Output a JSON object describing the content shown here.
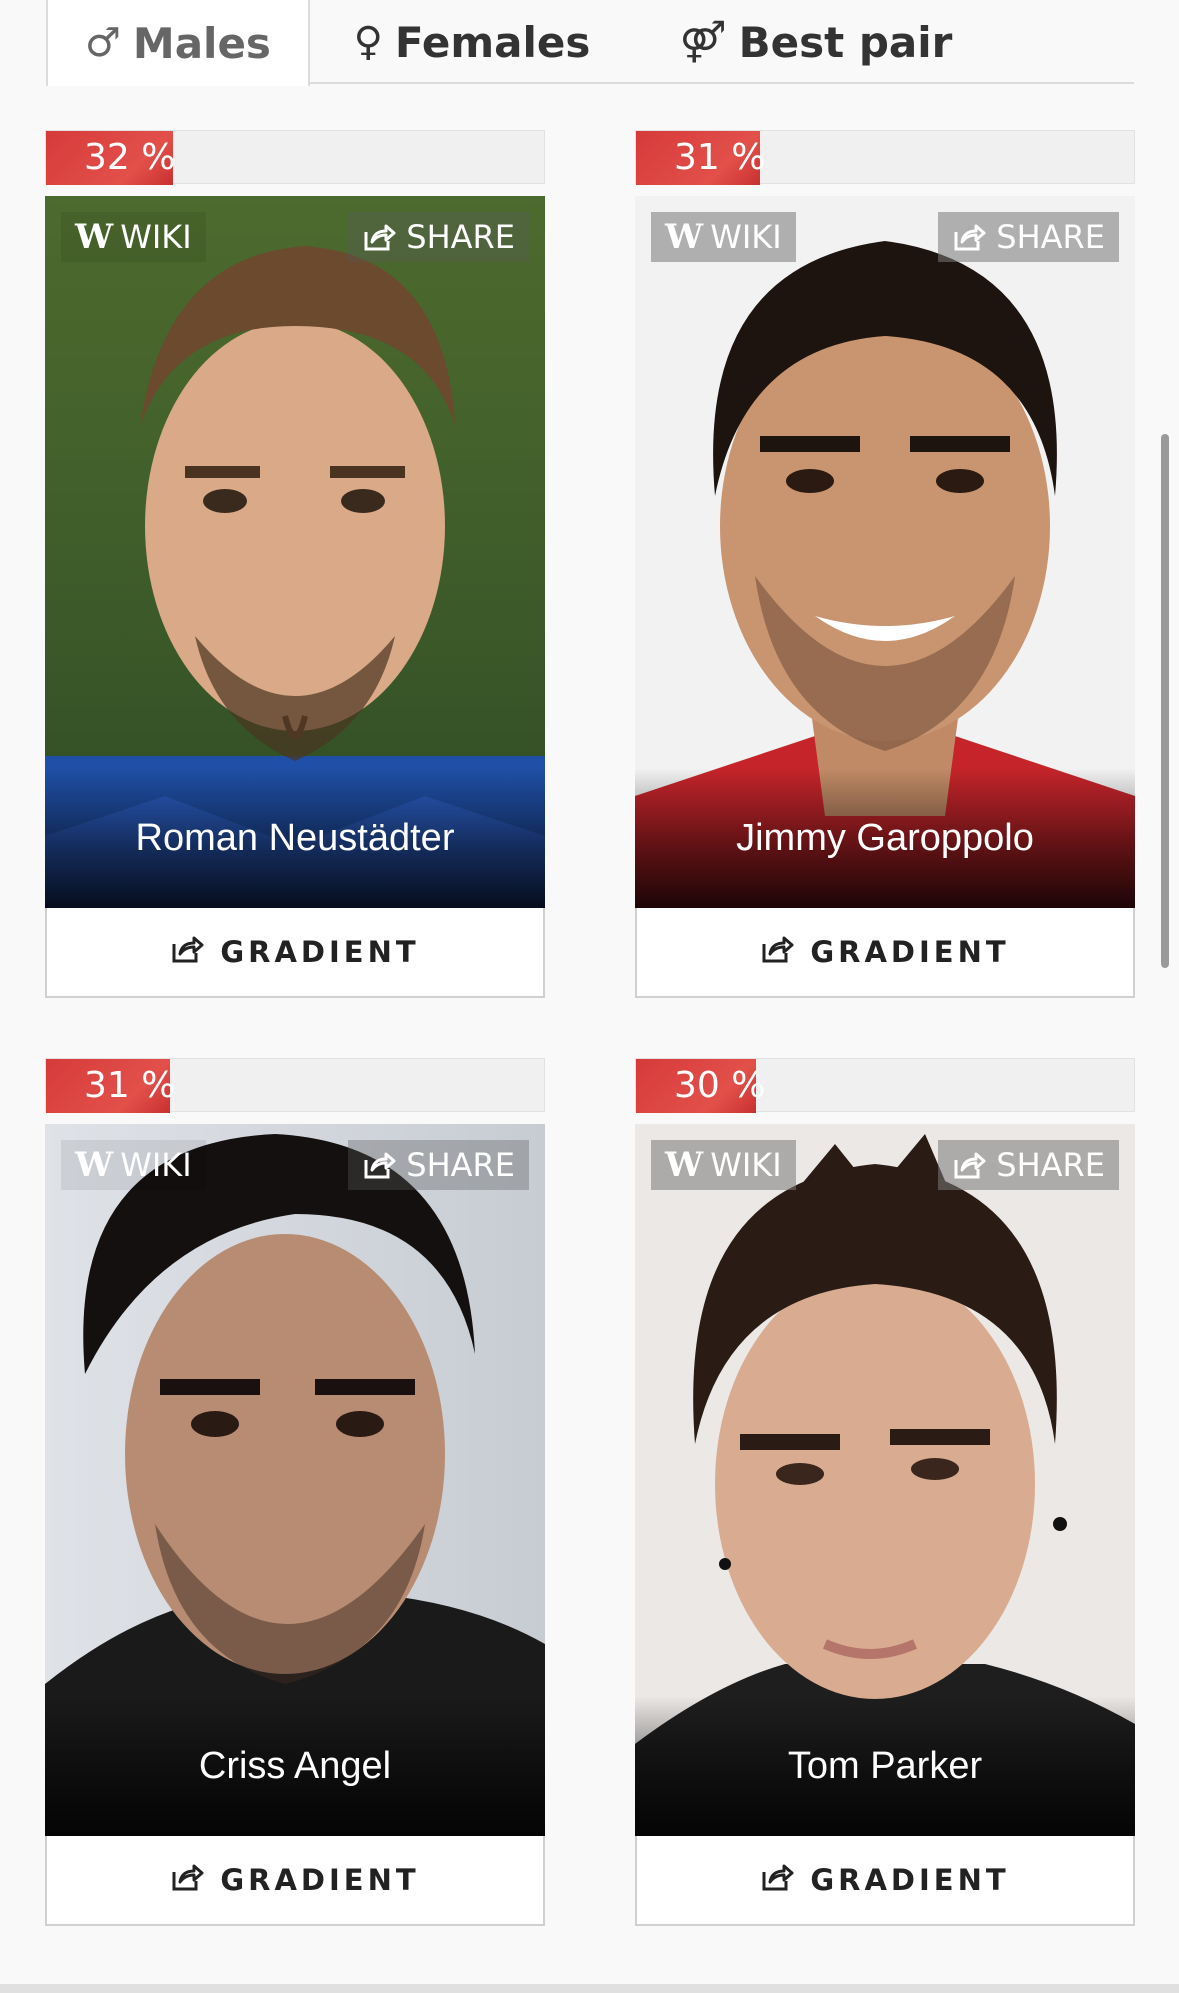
{
  "tabs": [
    {
      "symbol": "♂",
      "label": "Males",
      "active": true
    },
    {
      "symbol": "♀",
      "label": "Females",
      "active": false
    },
    {
      "symbol": "⚤",
      "label": "Best pair",
      "active": false
    }
  ],
  "button_labels": {
    "wiki": "WIKI",
    "share": "SHARE",
    "gradient": "GRADIENT"
  },
  "cards": [
    {
      "percent_text": "32 %",
      "percent": 32,
      "name": "Roman Neustädter"
    },
    {
      "percent_text": "31 %",
      "percent": 31,
      "name": "Jimmy Garoppolo"
    },
    {
      "percent_text": "31 %",
      "percent": 31,
      "name": "Criss Angel"
    },
    {
      "percent_text": "30 %",
      "percent": 30,
      "name": "Tom Parker"
    }
  ],
  "colors": {
    "accent_red": "#e0443f",
    "text_dark": "#222222"
  }
}
